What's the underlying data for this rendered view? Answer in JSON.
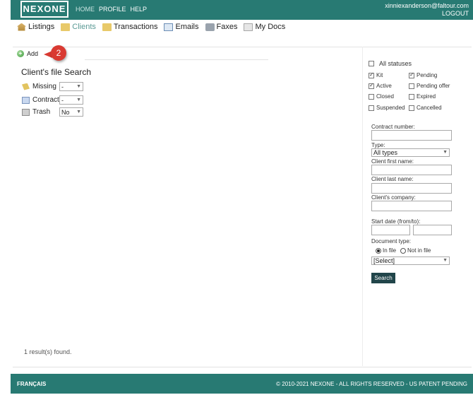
{
  "header": {
    "logo": "NEXONE",
    "nav": [
      "HOME",
      "PROFILE",
      "HELP"
    ],
    "user_email": "xinniexanderson@faltour.com",
    "logout": "LOGOUT"
  },
  "main_nav": [
    {
      "label": "Listings",
      "icon": "house-icon"
    },
    {
      "label": "Clients",
      "icon": "folder-icon"
    },
    {
      "label": "Transactions",
      "icon": "folder-icon"
    },
    {
      "label": "Emails",
      "icon": "envelope-icon"
    },
    {
      "label": "Faxes",
      "icon": "printer-icon"
    },
    {
      "label": "My Docs",
      "icon": "documents-icon"
    }
  ],
  "add_label": "Add",
  "marker_number": "2",
  "search_title": "Client's file Search",
  "filters": [
    {
      "label": "Missing",
      "value": "-"
    },
    {
      "label": "Contract",
      "value": "-"
    },
    {
      "label": "Trash",
      "value": "No"
    }
  ],
  "results_text": "1 result(s) found.",
  "statuses": {
    "all": {
      "label": "All statuses",
      "checked": false
    },
    "items": [
      {
        "label": "Kit",
        "checked": true
      },
      {
        "label": "Pending",
        "checked": true
      },
      {
        "label": "Active",
        "checked": true
      },
      {
        "label": "Pending offer",
        "checked": false
      },
      {
        "label": "Closed",
        "checked": false
      },
      {
        "label": "Expired",
        "checked": false
      },
      {
        "label": "Suspended",
        "checked": false
      },
      {
        "label": "Cancelled",
        "checked": false
      }
    ]
  },
  "form": {
    "contract_number_label": "Contract number:",
    "type_label": "Type:",
    "type_value": "All types",
    "first_name_label": "Client first name:",
    "last_name_label": "Client last name:",
    "company_label": "Client's company:",
    "start_date_label": "Start date (from/to):",
    "document_type_label": "Document type:",
    "in_file_label": "In file",
    "not_in_file_label": "Not in file",
    "document_select_value": "[Select]",
    "search_button": "Search"
  },
  "footer": {
    "language": "FRANÇAIS",
    "copyright": "© 2010-2021 NEXONE - ALL RIGHTS RESERVED - US PATENT PENDING"
  },
  "colors": {
    "brand_teal": "#287a73",
    "button_dark": "#21454a",
    "marker_red": "#d93a32"
  }
}
